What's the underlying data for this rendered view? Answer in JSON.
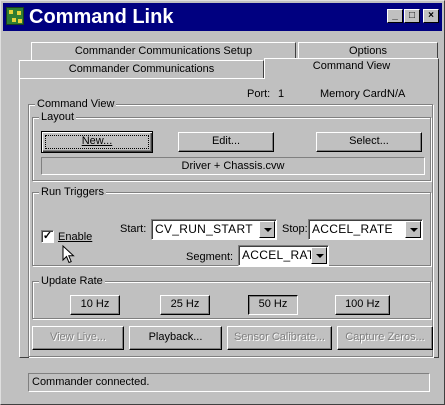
{
  "window": {
    "title": "Command Link",
    "minimize": "_",
    "maximize": "□",
    "close": "×",
    "icon": "command-link-app-icon"
  },
  "tabs": {
    "row_back": [
      "Commander Communications Setup",
      "Options"
    ],
    "row_front": [
      "Commander Communications",
      "Command View"
    ],
    "active": "Command View"
  },
  "info": {
    "port_label": "Port:",
    "port_value": "1",
    "memory_label": "Memory Card:",
    "memory_value": "N/A"
  },
  "command_view": {
    "legend": "Command View",
    "layout": {
      "legend": "Layout",
      "new_label": "New...",
      "edit_label": "Edit...",
      "select_label": "Select...",
      "current_file": "Driver + Chassis.cvw"
    }
  },
  "run_triggers": {
    "legend": "Run Triggers",
    "enable_label": "Enable",
    "enable_checked": true,
    "start_label": "Start:",
    "start_value": "CV_RUN_START",
    "stop_label": "Stop:",
    "stop_value": "ACCEL_RATE",
    "segment_label": "Segment:",
    "segment_value": "ACCEL_RATE"
  },
  "update_rate": {
    "legend": "Update Rate",
    "options": [
      "10 Hz",
      "25 Hz",
      "50 Hz",
      "100 Hz"
    ],
    "selected": "50 Hz"
  },
  "actions": {
    "view_live": "View Live...",
    "playback": "Playback...",
    "sensor_calibrate": "Sensor Calibrate...",
    "capture_zeros": "Capture Zeros..."
  },
  "status": {
    "text": "Commander connected."
  }
}
